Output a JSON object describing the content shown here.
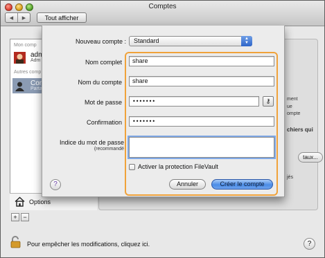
{
  "window": {
    "title": "Comptes",
    "show_all": "Tout afficher",
    "nav_back": "◀",
    "nav_forward": "▶"
  },
  "sidebar": {
    "my_account_header": "Mon comp",
    "my_account": {
      "name": "adm",
      "role": "Adm"
    },
    "other_accounts_header": "Autres comp",
    "selected_account": {
      "name": "Com",
      "role": "Parta"
    },
    "options_label": "Options",
    "add_label": "+",
    "remove_label": "−"
  },
  "background_panel": {
    "fragments": [
      "ment",
      "ue",
      "ompte",
      "chiers qui",
      "taux...",
      "jés"
    ]
  },
  "footer": {
    "lock_text": "Pour empêcher les modifications, cliquez ici.",
    "help": "?"
  },
  "sheet": {
    "new_account_label": "Nouveau compte :",
    "account_type": "Standard",
    "full_name_label": "Nom complet",
    "full_name_value": "share",
    "account_name_label": "Nom du compte",
    "account_name_value": "share",
    "password_label": "Mot de passe",
    "password_value": "•••••••",
    "confirm_label": "Confirmation",
    "confirm_value": "•••••••",
    "hint_label": "Indice du mot de passe",
    "hint_sublabel": "(recommandé",
    "hint_value": "",
    "filevault_label": "Activer la protection FileVault",
    "filevault_checked": false,
    "cancel_button": "Annuler",
    "create_button": "Créer le compte",
    "help": "?",
    "key_icon_glyph": "⚷",
    "focus_color": "#f0a23a",
    "default_button_color": "#4b8ce6"
  }
}
